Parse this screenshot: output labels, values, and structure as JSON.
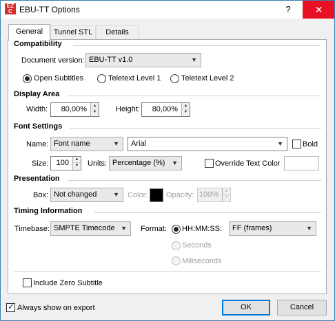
{
  "window": {
    "title": "EBU-TT Options",
    "help_label": "?",
    "close_label": "✕",
    "app_icon_text": "EZ C"
  },
  "tabs": [
    {
      "label": "General",
      "active": true
    },
    {
      "label": "Tunnel STL",
      "active": false
    },
    {
      "label": "Details",
      "active": false
    }
  ],
  "compatibility": {
    "header": "Compatibility",
    "doc_version_label": "Document version:",
    "doc_version_value": "EBU-TT v1.0",
    "radios": [
      {
        "label": "Open Subtitles",
        "checked": true
      },
      {
        "label": "Teletext Level 1",
        "checked": false
      },
      {
        "label": "Teletext Level 2",
        "checked": false
      }
    ]
  },
  "display_area": {
    "header": "Display Area",
    "width_label": "Width:",
    "width_value": "80,00%",
    "height_label": "Height:",
    "height_value": "80,00%"
  },
  "font_settings": {
    "header": "Font Settings",
    "name_label": "Name:",
    "name_mode": "Font name",
    "font_value": "Arial",
    "bold_label": "Bold",
    "size_label": "Size:",
    "size_value": "100",
    "units_label": "Units:",
    "units_value": "Percentage (%)",
    "override_label": "Override Text Color",
    "override_color_value": ""
  },
  "presentation": {
    "header": "Presentation",
    "box_label": "Box:",
    "box_value": "Not changed",
    "color_label": "Color:",
    "color_value": "#000000",
    "opacity_label": "Opacity:",
    "opacity_value": "100%"
  },
  "timing": {
    "header": "Timing Information",
    "timebase_label": "Timebase:",
    "timebase_value": "SMPTE Timecode",
    "format_label": "Format:",
    "format_options": [
      {
        "label": "HH:MM:SS",
        "checked": true,
        "enabled": true
      },
      {
        "label": "Seconds",
        "checked": false,
        "enabled": false
      },
      {
        "label": "Miliseconds",
        "checked": false,
        "enabled": false
      }
    ],
    "separator": ":",
    "frames_value": "FF (frames)"
  },
  "include_zero_subtitle": {
    "label": "Include Zero Subtitle",
    "checked": false
  },
  "always_show_on_export": {
    "label": "Always show on export",
    "checked": true
  },
  "buttons": {
    "ok": "OK",
    "cancel": "Cancel"
  },
  "colors": {
    "accent": "#0078d7",
    "close_red": "#e81123",
    "window_border": "#3c7fb1"
  }
}
